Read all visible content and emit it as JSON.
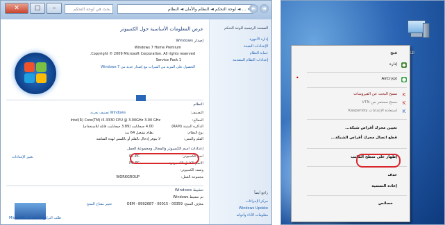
{
  "system_window": {
    "title_icons": {
      "close": "✕",
      "max": "□",
      "min": "–"
    },
    "address_path": "« … ◄ لوحة التحكم ◄ النظام والأمان ◄ النظام",
    "search_placeholder": "بحث في لوحة التحكم",
    "help_glyph": "?",
    "page_title": "عرض المعلومات الأساسية حول الكمبيوتر",
    "edition_header": "إصدار Windows",
    "edition_rows": [
      "Windows 7 Home Premium",
      "Copyright © 2009 Microsoft Corporation.  All rights reserved.",
      "Service Pack 1",
      "الحصول على المزيد من الميزات مع إصدار جديد من Windows 7"
    ],
    "system_header": "النظام",
    "system_labels": [
      "التصنيف:",
      "المعالج:",
      "الذاكرة المثبتة (RAM):",
      "نوع النظام:",
      "القلم والمس:"
    ],
    "system_values": [
      "Windows تصنيف تجربة",
      "Intel(R) Core(TM) i5-3330 CPU @ 3.00GHz  3.00 GHz",
      "4.00 جيجابايت (3.89 جيجابايت قابلة للاستخدام)",
      "نظام تشغيل 64 بت",
      "لا يتوفر إدخال بالقلم أو باللمس لهذه الشاشة"
    ],
    "network_header": "إعدادات اسم الكمبيوتر والمجال ومجموعة العمل",
    "network_labels": [
      "اسم الكمبيوتر:",
      "الاسم الكامل للكمبيوتر:",
      "وصف الكمبيوتر:",
      "مجموعة العمل:"
    ],
    "network_values": [
      "PC-PC",
      "PC-PC",
      "",
      "WORKGROUP"
    ],
    "change_settings": "تغيير الإعدادات",
    "activation_header": "تنشيط Windows",
    "activation_row": "تم تنشيط Windows",
    "product_id": "معرّف المنتج: 00359 - OEM - 8992687 - 00015",
    "change_key": "تغيير مفتاح المنتج",
    "partner_text": "طلب البرامج الأصلية من Microsoft"
  },
  "system_sidebar": {
    "header": "الصفحة الرئيسية للوحة التحكم",
    "items": [
      "إدارة الأجهزة",
      "الإعدادات البعيدة",
      "حماية النظام",
      "إعدادات النظام المتقدمة"
    ],
    "see_also_header": "راجع أيضاً",
    "see_also": [
      "مركز الإجراءات",
      "Windows Update",
      "معلومات الأداء وأدواته"
    ]
  },
  "desktop": {
    "computer_label": "الكمبيوتر",
    "menu_items": [
      {
        "label": "فتح",
        "style": "bold"
      },
      {
        "label": "إدارة",
        "style": "normal"
      },
      {
        "label": "AirCrypt",
        "style": "normal"
      },
      {
        "label": "مسح البحث عن الفيروسات",
        "style": "red"
      },
      {
        "label": "مسح مستمر من VTN",
        "style": "gray"
      },
      {
        "label": "استعادة الإعدادات Kaspersky",
        "style": "gray"
      },
      {
        "label": "تعيين محرك أقراص شبكة...",
        "style": "normal"
      },
      {
        "label": "قطع اتصال محرك أقراص الشبكة...",
        "style": "normal"
      },
      {
        "label": "إظهار على سطح المكتب",
        "style": "normal"
      },
      {
        "label": "حذف",
        "style": "normal"
      },
      {
        "label": "إعادة التسمية",
        "style": "normal"
      },
      {
        "label": "خصائص",
        "style": "bold"
      }
    ],
    "highlight_item": "خصائص"
  },
  "colors": {
    "highlight_ring": "#d9262c",
    "link": "#1b5fb0",
    "desktop": "#2a64b3"
  }
}
